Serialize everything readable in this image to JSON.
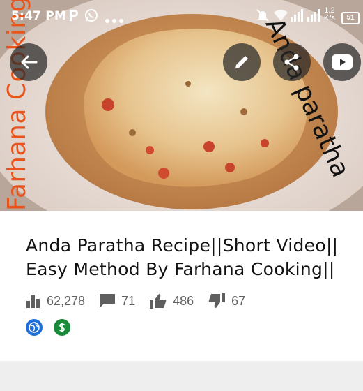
{
  "status_bar": {
    "time": "5:47 PM",
    "network_speed_value": "1.2",
    "network_speed_unit": "K/s",
    "battery_level": "51",
    "icons": [
      "parking-app-icon",
      "whatsapp-icon",
      "more-dots-icon",
      "mute-icon",
      "wifi-icon",
      "signal-icon",
      "signal-icon-2",
      "battery-icon"
    ]
  },
  "thumbnail": {
    "watermark_left": "Farhana Cooking",
    "watermark_right": "Anda paratha"
  },
  "toolbar": {
    "back_icon": "back-arrow-icon",
    "edit_icon": "pencil-icon",
    "share_icon": "share-icon",
    "youtube_icon": "youtube-icon"
  },
  "video": {
    "title": "Anda Paratha Recipe||Short Video|| Easy Method By Farhana Cooking||",
    "views": "62,278",
    "comments": "71",
    "likes": "486",
    "dislikes": "67"
  },
  "badges": {
    "globe_icon": "globe-icon",
    "dollar_icon": "dollar-icon"
  },
  "colors": {
    "watermark_orange": "#e8541b",
    "globe_blue": "#1e6fd9",
    "dollar_green": "#1b8a3a",
    "stat_gray": "#5f5f5f"
  }
}
